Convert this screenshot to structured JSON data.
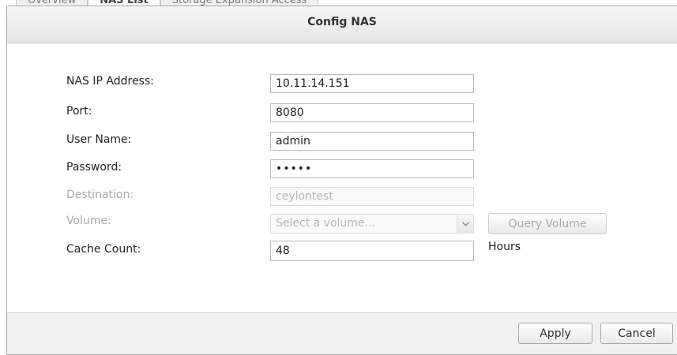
{
  "background_tabs": [
    {
      "label": "Overview"
    },
    {
      "label": "NAS List"
    },
    {
      "label": "Storage Expansion Access"
    }
  ],
  "dialog": {
    "title": "Config NAS"
  },
  "form": {
    "nas_ip": {
      "label": "NAS IP Address:",
      "value": "10.11.14.151"
    },
    "port": {
      "label": "Port:",
      "value": "8080"
    },
    "username": {
      "label": "User Name:",
      "value": "admin"
    },
    "password": {
      "label": "Password:",
      "value": "•••••"
    },
    "destination": {
      "label": "Destination:",
      "value": "ceylontest",
      "enabled": false
    },
    "volume": {
      "label": "Volume:",
      "placeholder": "Select a volume...",
      "enabled": false
    },
    "query_volume_label": "Query Volume",
    "cache_count": {
      "label": "Cache Count:",
      "value": "48",
      "unit": "Hours"
    }
  },
  "footer": {
    "apply_label": "Apply",
    "cancel_label": "Cancel"
  },
  "icons": {
    "select_arrow": "chevron-down-icon"
  },
  "colors": {
    "disabled_text": "#a9a9a9",
    "header_bg": "#ececec",
    "footer_bg": "#f1f1f1"
  }
}
